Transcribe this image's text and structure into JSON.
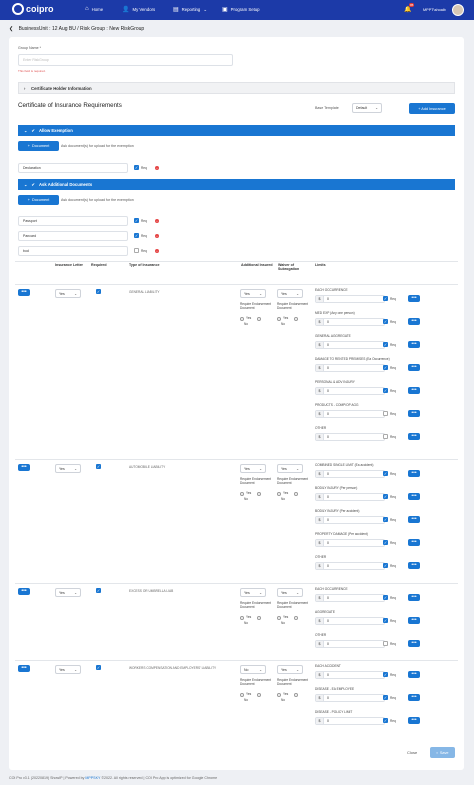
{
  "nav": {
    "logo": "coipro",
    "items": [
      {
        "label": "Home",
        "icon": "home-icon",
        "glyph": "⌂"
      },
      {
        "label": "My Vendors",
        "icon": "vendors-icon",
        "glyph": "👤"
      },
      {
        "label": "Reporting",
        "icon": "reporting-icon",
        "glyph": "▤",
        "chevron": "⌄"
      },
      {
        "label": "Program Setup",
        "icon": "program-setup-icon",
        "glyph": "▣"
      }
    ],
    "notif_count": "95",
    "user": "MPPT\\shoaib",
    "colors": {
      "bar": "#1c3aa8",
      "accent": "#1976d2"
    }
  },
  "breadcrumb": "BusinessUnit : 12 Aug BU / Risk Group : New RiskGroup",
  "form": {
    "group_name_label": "Group Name *",
    "group_name_placeholder": "Enter RiskGroup",
    "group_name_error": "This field is required.",
    "cert_holder_info": "Certificate Holder Information",
    "coi_title": "Certificate of Insurance Requirements",
    "base_template_label": "Base Template",
    "base_template_value": "Default",
    "add_insurance": "+ Add Insurance",
    "allow_exemption": "Allow Exemption",
    "document_btn": "Document",
    "exemption_hint": "Ask document(s) for upload for the exemption",
    "declaration_doc": "Declaration",
    "ask_additional": "Ask Additional Documents",
    "additional_hint": "Ask document(s) for upload for the exemption",
    "additional_docs": [
      {
        "name": "Passport",
        "checked": true
      },
      {
        "name": "Pancard",
        "checked": true
      },
      {
        "name": "bod",
        "checked": false
      }
    ],
    "req_label": "Req"
  },
  "table": {
    "headers": [
      "Insurance Letter",
      "Required",
      "Type of Insurance",
      "Additional Insured",
      "Waiver of Subrogation",
      "Limits"
    ],
    "req_endorse": "Require Endorsement Document",
    "yes": "Yes",
    "no": "No",
    "dollar": "$",
    "zero": "0",
    "row_btn": "•••",
    "rows": [
      {
        "letter": "Yes",
        "type": "GENERAL LIABILITY",
        "ai": "Yes",
        "ws": "Yes",
        "limits": [
          "EACH OCCURRENCE",
          "MED EXP (Any one person)",
          "GENERAL AGGREGATE",
          "DAMAGE TO RENTED PREMISES (Ea Occurrence)",
          "PERSONAL & ADV INJURY",
          "PRODUCTS - COMP/OP AGG",
          "OTHER"
        ],
        "checked": [
          true,
          true,
          true,
          true,
          true,
          false,
          false
        ]
      },
      {
        "letter": "Yes",
        "type": "AUTOMOBILE LIABILITY",
        "ai": "Yes",
        "ws": "Yes",
        "limits": [
          "COMBINED SINGLE LIMIT (Ea accident)",
          "BODILY INJURY (Per person)",
          "BODILY INJURY (Per accident)",
          "PROPERTY DAMAGE (Per accident)",
          "OTHER"
        ],
        "checked": [
          true,
          true,
          true,
          true,
          true
        ]
      },
      {
        "letter": "Yes",
        "type": "EXCESS OR UMBRELLA LIAB",
        "ai": "Yes",
        "ws": "Yes",
        "limits": [
          "EACH OCCURRENCE",
          "AGGREGATE",
          "OTHER"
        ],
        "checked": [
          true,
          true,
          false
        ]
      },
      {
        "letter": "Yes",
        "type": "WORKERS COMPENSATION AND EMPLOYERS' LIABILITY",
        "ai": "No",
        "ws": "Yes",
        "limits": [
          "EACH ACCIDENT",
          "DISEASE - EA EMPLOYEE",
          "DISEASE - POLICY LIMIT"
        ],
        "checked": [
          true,
          true,
          true
        ]
      }
    ]
  },
  "actions": {
    "close": "Close",
    "save": "Save"
  },
  "footer": {
    "prefix": "COI Pro v3.1 (20220819) ShowIP | Powered by",
    "brand": "MPPSKY",
    "suffix": "©2022. All rights reserved | COI Pro App is optimized for Google Chrome"
  }
}
